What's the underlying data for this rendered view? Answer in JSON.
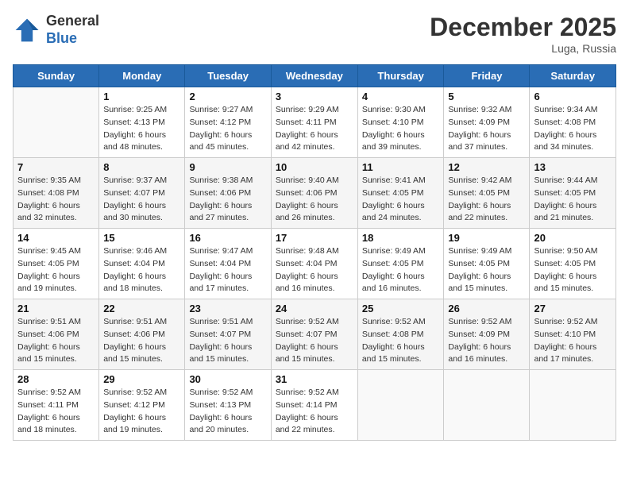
{
  "logo": {
    "general": "General",
    "blue": "Blue"
  },
  "title": "December 2025",
  "location": "Luga, Russia",
  "days_of_week": [
    "Sunday",
    "Monday",
    "Tuesday",
    "Wednesday",
    "Thursday",
    "Friday",
    "Saturday"
  ],
  "weeks": [
    [
      {
        "num": "",
        "info": ""
      },
      {
        "num": "1",
        "info": "Sunrise: 9:25 AM\nSunset: 4:13 PM\nDaylight: 6 hours\nand 48 minutes."
      },
      {
        "num": "2",
        "info": "Sunrise: 9:27 AM\nSunset: 4:12 PM\nDaylight: 6 hours\nand 45 minutes."
      },
      {
        "num": "3",
        "info": "Sunrise: 9:29 AM\nSunset: 4:11 PM\nDaylight: 6 hours\nand 42 minutes."
      },
      {
        "num": "4",
        "info": "Sunrise: 9:30 AM\nSunset: 4:10 PM\nDaylight: 6 hours\nand 39 minutes."
      },
      {
        "num": "5",
        "info": "Sunrise: 9:32 AM\nSunset: 4:09 PM\nDaylight: 6 hours\nand 37 minutes."
      },
      {
        "num": "6",
        "info": "Sunrise: 9:34 AM\nSunset: 4:08 PM\nDaylight: 6 hours\nand 34 minutes."
      }
    ],
    [
      {
        "num": "7",
        "info": "Sunrise: 9:35 AM\nSunset: 4:08 PM\nDaylight: 6 hours\nand 32 minutes."
      },
      {
        "num": "8",
        "info": "Sunrise: 9:37 AM\nSunset: 4:07 PM\nDaylight: 6 hours\nand 30 minutes."
      },
      {
        "num": "9",
        "info": "Sunrise: 9:38 AM\nSunset: 4:06 PM\nDaylight: 6 hours\nand 27 minutes."
      },
      {
        "num": "10",
        "info": "Sunrise: 9:40 AM\nSunset: 4:06 PM\nDaylight: 6 hours\nand 26 minutes."
      },
      {
        "num": "11",
        "info": "Sunrise: 9:41 AM\nSunset: 4:05 PM\nDaylight: 6 hours\nand 24 minutes."
      },
      {
        "num": "12",
        "info": "Sunrise: 9:42 AM\nSunset: 4:05 PM\nDaylight: 6 hours\nand 22 minutes."
      },
      {
        "num": "13",
        "info": "Sunrise: 9:44 AM\nSunset: 4:05 PM\nDaylight: 6 hours\nand 21 minutes."
      }
    ],
    [
      {
        "num": "14",
        "info": "Sunrise: 9:45 AM\nSunset: 4:05 PM\nDaylight: 6 hours\nand 19 minutes."
      },
      {
        "num": "15",
        "info": "Sunrise: 9:46 AM\nSunset: 4:04 PM\nDaylight: 6 hours\nand 18 minutes."
      },
      {
        "num": "16",
        "info": "Sunrise: 9:47 AM\nSunset: 4:04 PM\nDaylight: 6 hours\nand 17 minutes."
      },
      {
        "num": "17",
        "info": "Sunrise: 9:48 AM\nSunset: 4:04 PM\nDaylight: 6 hours\nand 16 minutes."
      },
      {
        "num": "18",
        "info": "Sunrise: 9:49 AM\nSunset: 4:05 PM\nDaylight: 6 hours\nand 16 minutes."
      },
      {
        "num": "19",
        "info": "Sunrise: 9:49 AM\nSunset: 4:05 PM\nDaylight: 6 hours\nand 15 minutes."
      },
      {
        "num": "20",
        "info": "Sunrise: 9:50 AM\nSunset: 4:05 PM\nDaylight: 6 hours\nand 15 minutes."
      }
    ],
    [
      {
        "num": "21",
        "info": "Sunrise: 9:51 AM\nSunset: 4:06 PM\nDaylight: 6 hours\nand 15 minutes."
      },
      {
        "num": "22",
        "info": "Sunrise: 9:51 AM\nSunset: 4:06 PM\nDaylight: 6 hours\nand 15 minutes."
      },
      {
        "num": "23",
        "info": "Sunrise: 9:51 AM\nSunset: 4:07 PM\nDaylight: 6 hours\nand 15 minutes."
      },
      {
        "num": "24",
        "info": "Sunrise: 9:52 AM\nSunset: 4:07 PM\nDaylight: 6 hours\nand 15 minutes."
      },
      {
        "num": "25",
        "info": "Sunrise: 9:52 AM\nSunset: 4:08 PM\nDaylight: 6 hours\nand 15 minutes."
      },
      {
        "num": "26",
        "info": "Sunrise: 9:52 AM\nSunset: 4:09 PM\nDaylight: 6 hours\nand 16 minutes."
      },
      {
        "num": "27",
        "info": "Sunrise: 9:52 AM\nSunset: 4:10 PM\nDaylight: 6 hours\nand 17 minutes."
      }
    ],
    [
      {
        "num": "28",
        "info": "Sunrise: 9:52 AM\nSunset: 4:11 PM\nDaylight: 6 hours\nand 18 minutes."
      },
      {
        "num": "29",
        "info": "Sunrise: 9:52 AM\nSunset: 4:12 PM\nDaylight: 6 hours\nand 19 minutes."
      },
      {
        "num": "30",
        "info": "Sunrise: 9:52 AM\nSunset: 4:13 PM\nDaylight: 6 hours\nand 20 minutes."
      },
      {
        "num": "31",
        "info": "Sunrise: 9:52 AM\nSunset: 4:14 PM\nDaylight: 6 hours\nand 22 minutes."
      },
      {
        "num": "",
        "info": ""
      },
      {
        "num": "",
        "info": ""
      },
      {
        "num": "",
        "info": ""
      }
    ]
  ]
}
